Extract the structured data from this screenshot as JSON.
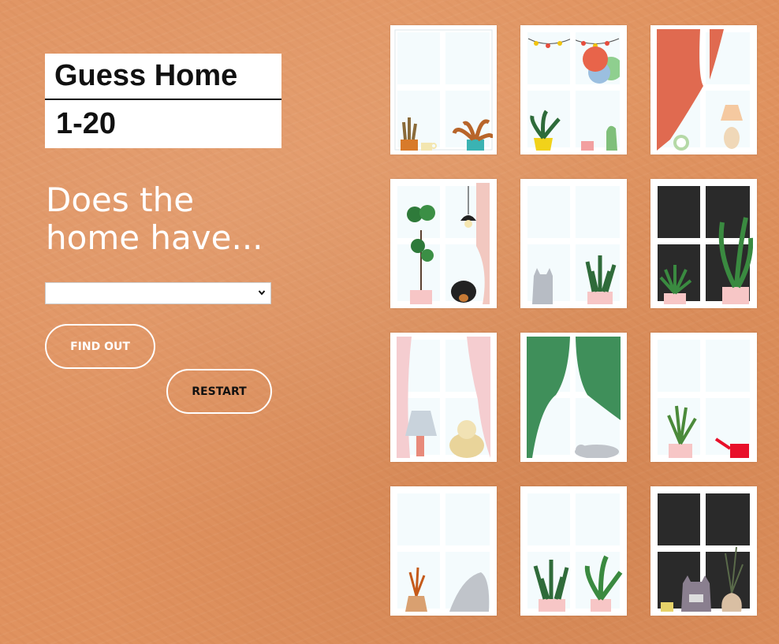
{
  "game": {
    "title": "Guess Home",
    "range": "1-20",
    "question": "Does the home have...",
    "select_value": "",
    "find_out_label": "FIND OUT",
    "restart_label": "RESTART"
  },
  "colors": {
    "wall": "#e0925f",
    "pane_light": "#f4fbfd",
    "pane_dark": "#2a2a2a",
    "frame": "#ffffff"
  },
  "tiles": [
    {
      "name": "home-tile-1",
      "items": [
        "cactus-plant-icon",
        "mug-icon",
        "leafy-plant-icon"
      ]
    },
    {
      "name": "home-tile-2",
      "items": [
        "string-lights-icon",
        "balloon-icon",
        "potted-plant-icon",
        "mug-icon",
        "toy-dinosaur-icon"
      ]
    },
    {
      "name": "home-tile-3",
      "items": [
        "red-curtain-icon",
        "alarm-clock-icon",
        "table-lamp-icon"
      ]
    },
    {
      "name": "home-tile-4",
      "items": [
        "fiddle-leaf-tree-icon",
        "pendant-lamp-icon",
        "dachshund-dog-icon",
        "pink-curtain-icon"
      ]
    },
    {
      "name": "home-tile-5",
      "items": [
        "gray-cat-icon",
        "snake-plant-icon"
      ]
    },
    {
      "name": "home-tile-6",
      "items": [
        "night-window-icon",
        "palm-plant-icon",
        "tall-plant-icon"
      ]
    },
    {
      "name": "home-tile-7",
      "items": [
        "pink-curtain-icon",
        "table-lamp-icon",
        "sheepdog-icon"
      ]
    },
    {
      "name": "home-tile-8",
      "items": [
        "green-curtain-icon",
        "sleeping-cat-icon"
      ]
    },
    {
      "name": "home-tile-9",
      "items": [
        "herb-plant-icon",
        "watering-can-icon"
      ]
    },
    {
      "name": "home-tile-10",
      "items": [
        "dried-flowers-vase-icon",
        "stretching-cat-icon"
      ]
    },
    {
      "name": "home-tile-11",
      "items": [
        "snake-plant-icon",
        "leafy-plant-icon"
      ]
    },
    {
      "name": "home-tile-12",
      "items": [
        "night-window-icon",
        "schnauzer-dog-icon",
        "mug-icon",
        "vase-icon"
      ]
    }
  ]
}
